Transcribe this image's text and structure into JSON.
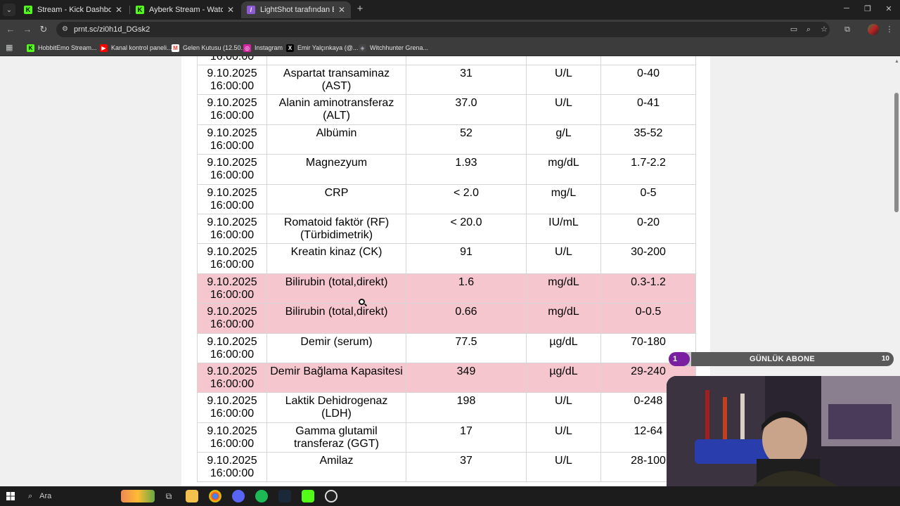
{
  "browser": {
    "tabs": [
      {
        "title": "Stream - Kick Dashboard",
        "favicon": "kick-icon",
        "active": false
      },
      {
        "title": "Ayberk Stream - Watch Live on",
        "favicon": "kick-icon",
        "active": false
      },
      {
        "title": "LightShot tarafından Ekran Gör",
        "favicon": "lightshot-icon",
        "active": true
      }
    ],
    "url": "prnt.sc/zi0h1d_DGsk2",
    "bookmarks": [
      {
        "label": "HobbitEmo Stream...",
        "icon": "kick-icon",
        "color": "#53fc18"
      },
      {
        "label": "Kanal kontrol paneli...",
        "icon": "youtube-icon",
        "color": "#ff0000"
      },
      {
        "label": "Gelen Kutusu (12.50...",
        "icon": "gmail-icon",
        "color": "#ea4335"
      },
      {
        "label": "Instagram",
        "icon": "instagram-icon",
        "color": "#d6249f"
      },
      {
        "label": "Emir Yalçınkaya (@...",
        "icon": "x-icon",
        "color": "#000000"
      },
      {
        "label": "Witchhunter Grena...",
        "icon": "shield-icon",
        "color": "#8a8aff"
      }
    ]
  },
  "report": {
    "highlight_color": "#f6c6cf",
    "top_partial_date": "16:00:00",
    "rows": [
      {
        "date": "9.10.2025",
        "time": "16:00:00",
        "test": "Aspartat transaminaz (AST)",
        "value": "31",
        "unit": "U/L",
        "ref": "0-40",
        "flag": false
      },
      {
        "date": "9.10.2025",
        "time": "16:00:00",
        "test": "Alanin aminotransferaz (ALT)",
        "value": "37.0",
        "unit": "U/L",
        "ref": "0-41",
        "flag": false
      },
      {
        "date": "9.10.2025",
        "time": "16:00:00",
        "test": "Albümin",
        "value": "52",
        "unit": "g/L",
        "ref": "35-52",
        "flag": false
      },
      {
        "date": "9.10.2025",
        "time": "16:00:00",
        "test": "Magnezyum",
        "value": "1.93",
        "unit": "mg/dL",
        "ref": "1.7-2.2",
        "flag": false
      },
      {
        "date": "9.10.2025",
        "time": "16:00:00",
        "test": "CRP",
        "value": "< 2.0",
        "unit": "mg/L",
        "ref": "0-5",
        "flag": false
      },
      {
        "date": "9.10.2025",
        "time": "16:00:00",
        "test": "Romatoid faktör (RF) (Türbidimetrik)",
        "value": "< 20.0",
        "unit": "IU/mL",
        "ref": "0-20",
        "flag": false
      },
      {
        "date": "9.10.2025",
        "time": "16:00:00",
        "test": "Kreatin kinaz (CK)",
        "value": "91",
        "unit": "U/L",
        "ref": "30-200",
        "flag": false
      },
      {
        "date": "9.10.2025",
        "time": "16:00:00",
        "test": "Bilirubin (total,direkt)",
        "value": "1.6",
        "unit": "mg/dL",
        "ref": "0.3-1.2",
        "flag": true
      },
      {
        "date": "9.10.2025",
        "time": "16:00:00",
        "test": "Bilirubin (total,direkt)",
        "value": "0.66",
        "unit": "mg/dL",
        "ref": "0-0.5",
        "flag": true
      },
      {
        "date": "9.10.2025",
        "time": "16:00:00",
        "test": "Demir (serum)",
        "value": "77.5",
        "unit": "µg/dL",
        "ref": "70-180",
        "flag": false
      },
      {
        "date": "9.10.2025",
        "time": "16:00:00",
        "test": "Demir Bağlama Kapasitesi",
        "value": "349",
        "unit": "µg/dL",
        "ref": "29-240",
        "flag": true
      },
      {
        "date": "9.10.2025",
        "time": "16:00:00",
        "test": "Laktik Dehidrogenaz (LDH)",
        "value": "198",
        "unit": "U/L",
        "ref": "0-248",
        "flag": false
      },
      {
        "date": "9.10.2025",
        "time": "16:00:00",
        "test": "Gamma glutamil transferaz (GGT)",
        "value": "17",
        "unit": "U/L",
        "ref": "12-64",
        "flag": false
      },
      {
        "date": "9.10.2025",
        "time": "16:00:00",
        "test": "Amilaz",
        "value": "37",
        "unit": "U/L",
        "ref": "28-100",
        "flag": false
      }
    ]
  },
  "stream_overlay": {
    "sub_count": "1",
    "sub_label": "GÜNLÜK ABONE",
    "sub_goal": "10",
    "sub_progress": 0.1
  },
  "taskbar": {
    "search_placeholder": "Ara"
  }
}
